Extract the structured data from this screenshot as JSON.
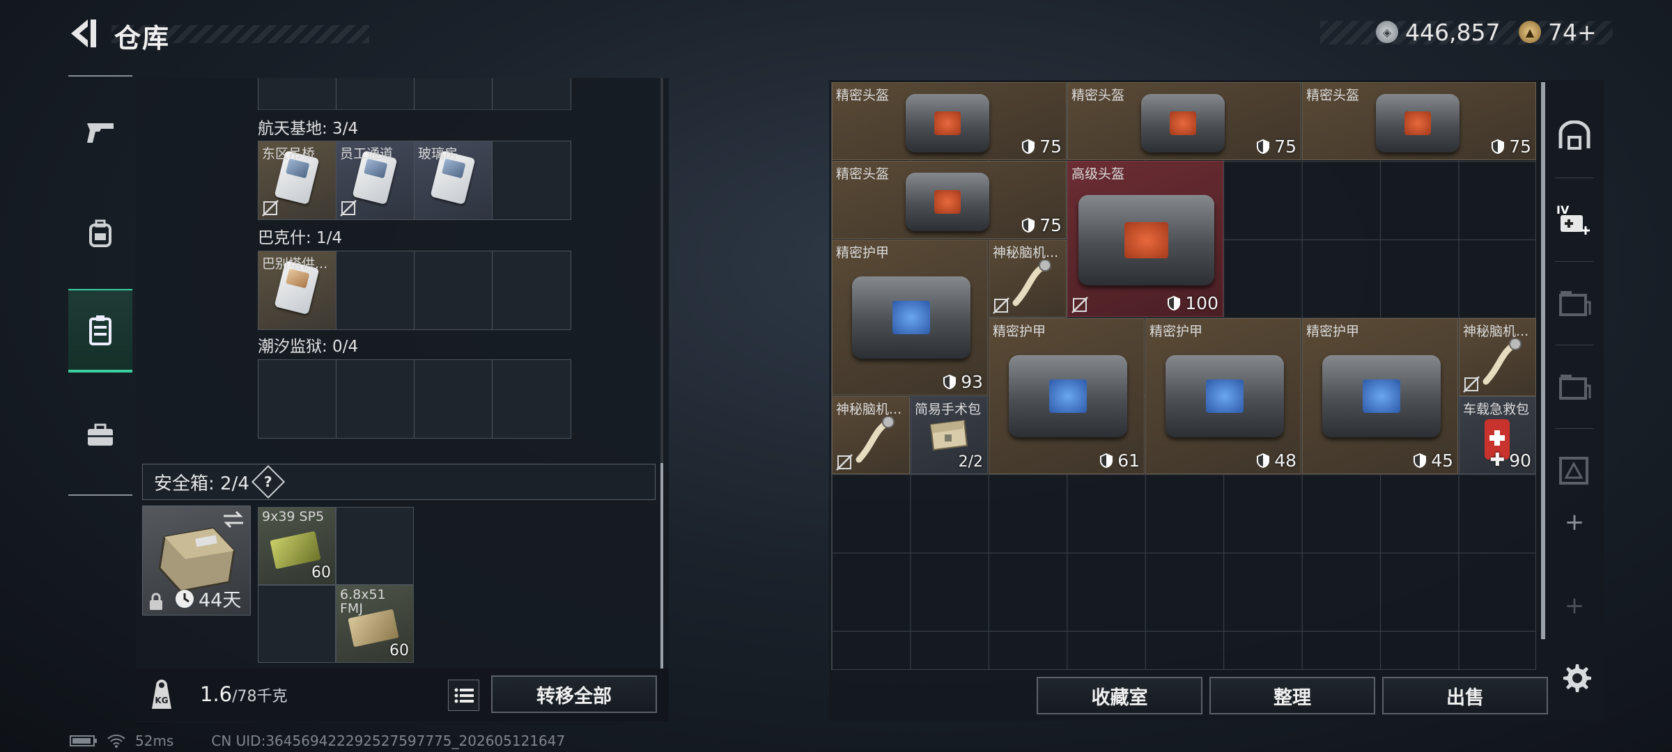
{
  "header": {
    "title": "仓库"
  },
  "currency": {
    "silver": "446,857",
    "gold": "74+"
  },
  "keys": {
    "sections": [
      {
        "title": "航天基地: 3/4",
        "cards": [
          "东区吊桥",
          "员工通道",
          "玻璃房"
        ]
      },
      {
        "title": "巴克什: 1/4",
        "cards": [
          "巴别塔供..."
        ]
      },
      {
        "title": "潮汐监狱: 0/4",
        "cards": []
      }
    ]
  },
  "safe": {
    "title": "安全箱: 2/4",
    "help": "?",
    "days": "44天",
    "ammo": [
      {
        "label": "9x39 SP5",
        "count": "60"
      },
      {
        "label": "6.8x51 FMJ",
        "count": "60"
      }
    ]
  },
  "weight": {
    "value": "1.6",
    "max": "/78千克"
  },
  "buttons": {
    "transfer_all": "转移全部",
    "collection": "收藏室",
    "sort": "整理",
    "sell": "出售"
  },
  "stash": {
    "items": [
      {
        "label": "精密头盔",
        "value": "75"
      },
      {
        "label": "精密头盔",
        "value": "75"
      },
      {
        "label": "精密头盔",
        "value": "75"
      },
      {
        "label": "精密头盔",
        "value": "75"
      },
      {
        "label": "高级头盔",
        "value": "100"
      },
      {
        "label": "精密护甲",
        "value": "93"
      },
      {
        "label": "神秘脑机...",
        "value": ""
      },
      {
        "label": "精密护甲",
        "value": "61"
      },
      {
        "label": "精密护甲",
        "value": "48"
      },
      {
        "label": "精密护甲",
        "value": "45"
      },
      {
        "label": "神秘脑机...",
        "value": ""
      },
      {
        "label": "神秘脑机...",
        "value": ""
      },
      {
        "label": "简易手术包",
        "value": "2/2"
      },
      {
        "label": "车载急救包",
        "value": "90"
      }
    ]
  },
  "status": {
    "ping": "52ms",
    "uid": "CN UID:364569422292527597775_202605121647"
  }
}
